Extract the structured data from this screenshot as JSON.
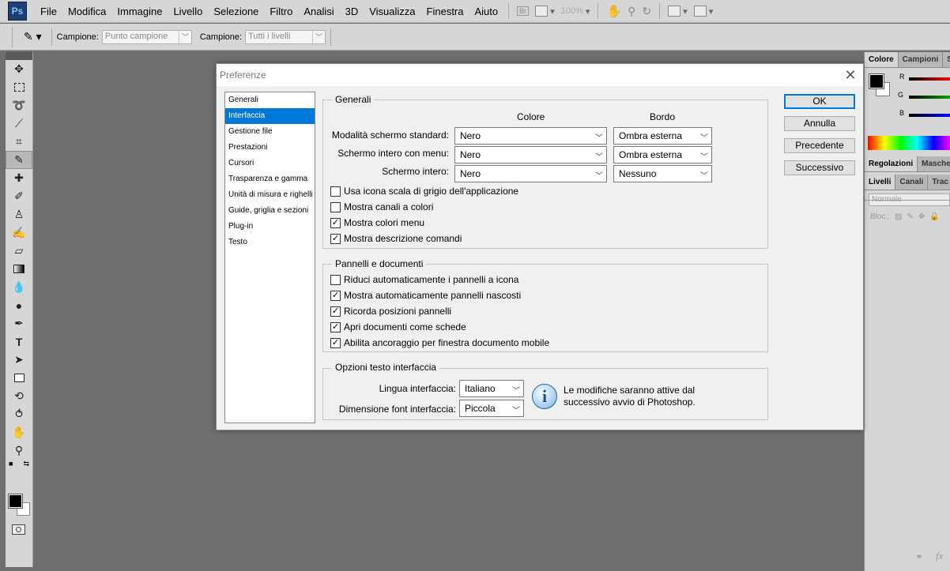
{
  "app": {
    "logo": "Ps"
  },
  "menubar": {
    "items": [
      "File",
      "Modifica",
      "Immagine",
      "Livello",
      "Selezione",
      "Filtro",
      "Analisi",
      "3D",
      "Visualizza",
      "Finestra",
      "Aiuto"
    ],
    "bridge_label": "Br",
    "zoom": "100%"
  },
  "options_bar": {
    "sample_label_1": "Campione:",
    "sample_value_1": "Punto campione",
    "sample_label_2": "Campione:",
    "sample_value_2": "Tutti i livelli"
  },
  "right_panel": {
    "tabs_top": [
      "Colore",
      "Campioni",
      "S"
    ],
    "channels": [
      "R",
      "G",
      "B"
    ],
    "tabs_mid": [
      "Regolazioni",
      "Masche"
    ],
    "tabs_layers": [
      "Livelli",
      "Canali",
      "Trac"
    ],
    "blend_mode": "Normale",
    "lock_label": "Bloc.:",
    "fx_label": "fx"
  },
  "dialog": {
    "title": "Preferenze",
    "categories": [
      "Generali",
      "Interfaccia",
      "Gestione file",
      "Prestazioni",
      "Cursori",
      "Trasparenza e gamma",
      "Unità di misura e righelli",
      "Guide, griglia e sezioni",
      "Plug-in",
      "Testo"
    ],
    "selected_category": "Interfaccia",
    "buttons": {
      "ok": "OK",
      "cancel": "Annulla",
      "prev": "Precedente",
      "next": "Successivo"
    },
    "general": {
      "legend": "Generali",
      "col_color": "Colore",
      "col_border": "Bordo",
      "rows": [
        {
          "label": "Modalità schermo standard:",
          "color": "Nero",
          "border": "Ombra esterna"
        },
        {
          "label": "Schermo intero con menu:",
          "color": "Nero",
          "border": "Ombra esterna"
        },
        {
          "label": "Schermo intero:",
          "color": "Nero",
          "border": "Nessuno"
        }
      ],
      "checkboxes": [
        {
          "label": "Usa icona scala di grigio dell'applicazione",
          "checked": false
        },
        {
          "label": "Mostra canali a colori",
          "checked": false
        },
        {
          "label": "Mostra colori menu",
          "checked": true
        },
        {
          "label": "Mostra descrizione comandi",
          "checked": true
        }
      ]
    },
    "panels": {
      "legend": "Pannelli e documenti",
      "checkboxes": [
        {
          "label": "Riduci automaticamente i pannelli a icona",
          "checked": false
        },
        {
          "label": "Mostra automaticamente pannelli nascosti",
          "checked": true
        },
        {
          "label": "Ricorda posizioni pannelli",
          "checked": true
        },
        {
          "label": "Apri documenti come schede",
          "checked": true
        },
        {
          "label": "Abilita ancoraggio per finestra documento mobile",
          "checked": true
        }
      ]
    },
    "text_options": {
      "legend": "Opzioni testo interfaccia",
      "language_label": "Lingua interfaccia:",
      "language_value": "Italiano",
      "font_size_label": "Dimensione font interfaccia:",
      "font_size_value": "Piccola",
      "info_line1": "Le modifiche saranno attive dal",
      "info_line2": "successivo avvio di Photoshop."
    }
  }
}
